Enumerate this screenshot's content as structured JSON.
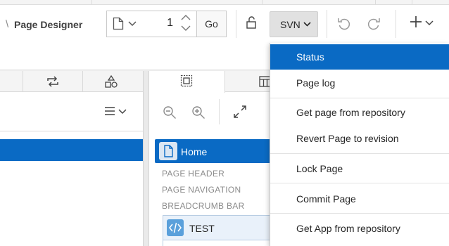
{
  "header": {
    "breadcrumb_sep": "\\",
    "title": "Page Designer"
  },
  "toolbar": {
    "page_number": "1",
    "go_label": "Go",
    "svn_label": "SVN"
  },
  "svn_menu": {
    "items": [
      {
        "label": "Status"
      },
      {
        "label": "Page log"
      },
      {
        "label": "Get page from repository"
      },
      {
        "label": "Revert Page to revision"
      },
      {
        "label": "Lock Page"
      },
      {
        "label": "Commit Page"
      },
      {
        "label": "Get App from repository"
      }
    ]
  },
  "layout_tree": {
    "page_name": "Home",
    "regions": [
      "PAGE HEADER",
      "PAGE NAVIGATION",
      "BREADCRUMB BAR"
    ],
    "selected_region": "TEST"
  },
  "icons": {
    "page_icon": "page-icon",
    "lock": "unlock-icon",
    "undo": "undo-icon",
    "redo": "redo-icon",
    "create": "plus-icon",
    "shared": "refresh-arrows-icon",
    "components": "shapes-icon",
    "zoom_out": "zoom-out-icon",
    "zoom_in": "zoom-in-icon",
    "expand": "expand-icon",
    "plsql": "code-icon"
  },
  "colors": {
    "accent": "#0a6ac4",
    "selected_text": "#ffffff",
    "region_label": "#8c8c8c"
  }
}
